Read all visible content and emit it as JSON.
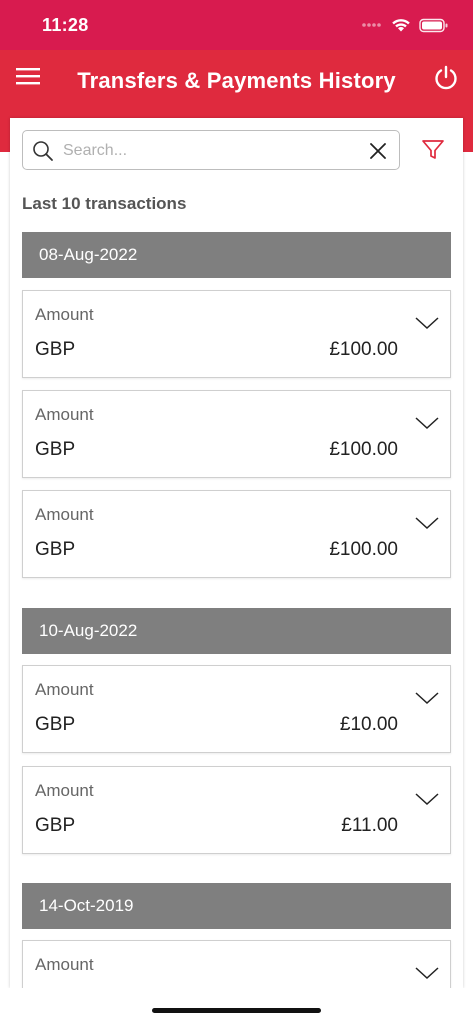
{
  "status_bar": {
    "time": "11:28"
  },
  "header": {
    "title": "Transfers & Payments History"
  },
  "search": {
    "placeholder": "Search...",
    "value": ""
  },
  "caption": "Last 10 transactions",
  "groups": [
    {
      "date": "08-Aug-2022",
      "transactions": [
        {
          "label": "Amount",
          "currency": "GBP",
          "value": "£100.00"
        },
        {
          "label": "Amount",
          "currency": "GBP",
          "value": "£100.00"
        },
        {
          "label": "Amount",
          "currency": "GBP",
          "value": "£100.00"
        }
      ]
    },
    {
      "date": "10-Aug-2022",
      "transactions": [
        {
          "label": "Amount",
          "currency": "GBP",
          "value": "£10.00"
        },
        {
          "label": "Amount",
          "currency": "GBP",
          "value": "£11.00"
        }
      ]
    },
    {
      "date": "14-Oct-2019",
      "transactions": [
        {
          "label": "Amount"
        }
      ]
    }
  ],
  "colors": {
    "status_bar": "#d81b4f",
    "header": "#df2a3e",
    "date_header": "#7f7f7f",
    "accent": "#df2a3e"
  },
  "icons": [
    "menu-icon",
    "power-icon",
    "search-icon",
    "clear-icon",
    "filter-icon",
    "chevron-down-icon",
    "wifi-icon",
    "battery-icon",
    "cellular-icon"
  ]
}
